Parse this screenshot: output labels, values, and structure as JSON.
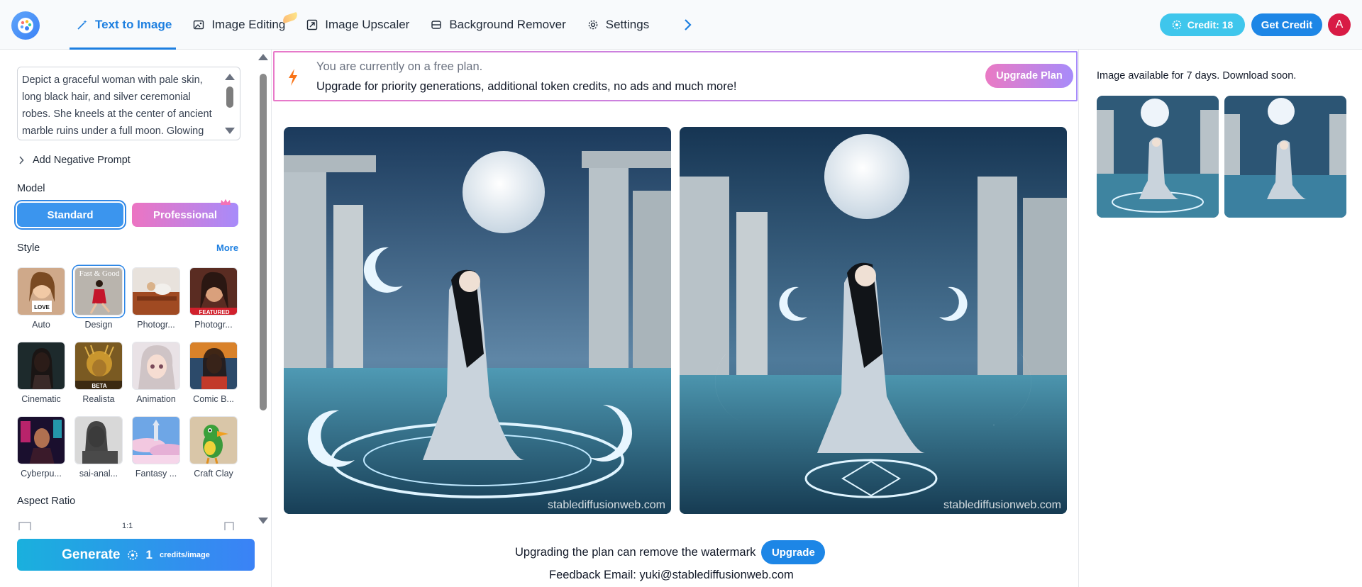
{
  "nav": {
    "items": [
      {
        "label": "Text to Image",
        "icon": "magic-wand-icon",
        "active": true
      },
      {
        "label": "Image Editing",
        "icon": "image-edit-icon",
        "active": false
      },
      {
        "label": "Image Upscaler",
        "icon": "upscale-icon",
        "active": false
      },
      {
        "label": "Background Remover",
        "icon": "eraser-icon",
        "active": false
      },
      {
        "label": "Settings",
        "icon": "gear-icon",
        "active": false
      }
    ]
  },
  "header": {
    "credit_label": "Credit: 18",
    "get_credit_label": "Get Credit",
    "avatar_initial": "A",
    "accent_color": "#1d86e6",
    "credit_color": "#3fc6ec",
    "avatar_color": "#d81b45"
  },
  "left": {
    "prompt_text": "Depict a graceful woman with pale skin, long black hair, and silver ceremonial robes. She kneels at the center of ancient marble ruins under a full moon. Glowing",
    "negative_prompt_label": "Add Negative Prompt",
    "model_label": "Model",
    "models": [
      {
        "label": "Standard",
        "selected": true
      },
      {
        "label": "Professional",
        "selected": false
      }
    ],
    "style_label": "Style",
    "more_label": "More",
    "styles": [
      {
        "label": "Auto",
        "selected": false
      },
      {
        "label": "Design",
        "selected": true
      },
      {
        "label": "Photogr...",
        "selected": false
      },
      {
        "label": "Photogr...",
        "selected": false
      },
      {
        "label": "Cinematic",
        "selected": false
      },
      {
        "label": "Realista",
        "selected": false
      },
      {
        "label": "Animation",
        "selected": false
      },
      {
        "label": "Comic B...",
        "selected": false
      },
      {
        "label": "Cyberpu...",
        "selected": false
      },
      {
        "label": "sai-anal...",
        "selected": false
      },
      {
        "label": "Fantasy ...",
        "selected": false
      },
      {
        "label": "Craft Clay",
        "selected": false
      }
    ],
    "style_thumb_texts": {
      "auto_sign": "LOVE",
      "design_title": "Fast & Good",
      "featured_badge": "FEATURED",
      "beta_badge": "BETA"
    },
    "aspect_ratio_label": "Aspect Ratio",
    "aspect_ratio_value": "1:1",
    "generate": {
      "label": "Generate",
      "credits_number": "1",
      "credits_unit": "credits/image"
    }
  },
  "main": {
    "banner_line1": "You are currently on a free plan.",
    "banner_line2": "Upgrade for priority generations, additional token credits, no ads and much more!",
    "upgrade_plan_label": "Upgrade Plan",
    "watermark_text": "stablediffusionweb.com",
    "watermark_note": "Upgrading the plan can remove the watermark",
    "upgrade_label": "Upgrade",
    "feedback_text": "Feedback Email: yuki@stablediffusionweb.com"
  },
  "right": {
    "availability_note": "Image available for 7 days. Download soon."
  }
}
